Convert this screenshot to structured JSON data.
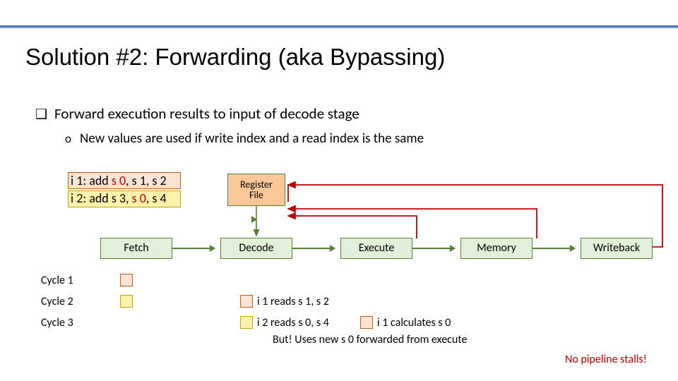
{
  "title": "Solution #2: Forwarding (aka Bypassing)",
  "bullet_main": "Forward execution results to input of decode stage",
  "bullet_sub": "New values are used if write index and a read index is the same",
  "instr1_prefix": "i 1: add ",
  "instr1_s0": "s 0",
  "instr1_rest": ", s 1, s 2",
  "instr2_prefix": "i 2: add s 3, ",
  "instr2_s0": "s 0",
  "instr2_rest": ", s 4",
  "register_file": "Register\nFile",
  "stages": {
    "fetch": "Fetch",
    "decode": "Decode",
    "execute": "Execute",
    "memory": "Memory",
    "writeback": "Writeback"
  },
  "cycles": {
    "c1": "Cycle 1",
    "c2": "Cycle 2",
    "c3": "Cycle 3"
  },
  "note_c2": "i 1 reads s 1, s 2",
  "note_c3a": "i 2 reads s 0, s 4",
  "note_c3b": "i 1 calculates s 0",
  "note_but": "But! Uses new s 0 forwarded from execute",
  "note_final": "No pipeline stalls!"
}
